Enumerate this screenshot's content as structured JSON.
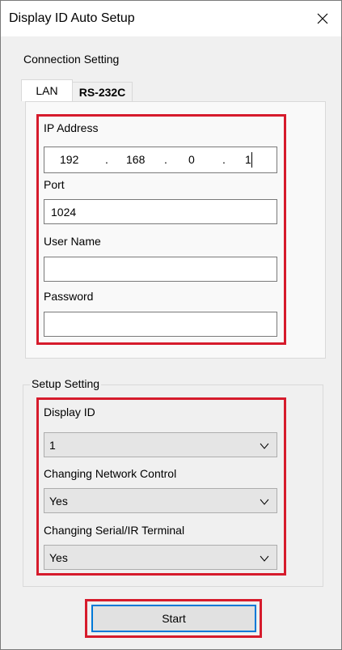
{
  "window": {
    "title": "Display ID Auto Setup",
    "close_icon": "close-icon"
  },
  "connection": {
    "title": "Connection Setting",
    "tabs": [
      {
        "label": "LAN",
        "active": true
      },
      {
        "label": "RS-232C",
        "active": false
      }
    ],
    "ip_label": "IP Address",
    "ip": [
      "192",
      "168",
      "0",
      "1"
    ],
    "ip_separator": ".",
    "port_label": "Port",
    "port_value": "1024",
    "username_label": "User Name",
    "username_value": "",
    "password_label": "Password",
    "password_value": ""
  },
  "setup": {
    "title": "Setup Setting",
    "display_id_label": "Display ID",
    "display_id_value": "1",
    "network_label": "Changing Network Control",
    "network_value": "Yes",
    "serial_label": "Changing Serial/IR Terminal",
    "serial_value": "Yes"
  },
  "start_label": "Start",
  "colors": {
    "highlight": "#d61b2c",
    "focus": "#0078d7",
    "window_bg": "#f0f0f0"
  }
}
